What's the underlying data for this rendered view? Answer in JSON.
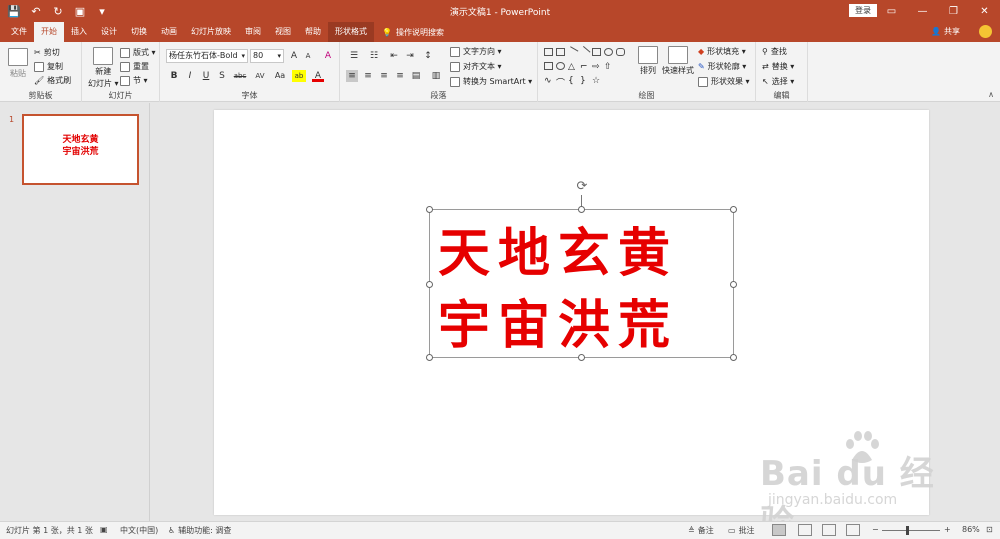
{
  "window": {
    "title": "演示文稿1  -  PowerPoint",
    "login": "登录",
    "minimize": "—",
    "restore": "❐",
    "close": "✕"
  },
  "qat": {
    "save": "💾",
    "undo": "↶",
    "redo": "↻",
    "present": "▣",
    "more": "▾"
  },
  "tabs": [
    {
      "label": "文件"
    },
    {
      "label": "开始"
    },
    {
      "label": "插入"
    },
    {
      "label": "设计"
    },
    {
      "label": "切换"
    },
    {
      "label": "动画"
    },
    {
      "label": "幻灯片放映"
    },
    {
      "label": "审阅"
    },
    {
      "label": "视图"
    },
    {
      "label": "帮助"
    },
    {
      "label": "形状格式"
    }
  ],
  "tell_me": "操作说明搜索",
  "share": "共享",
  "ribbon": {
    "clipboard": {
      "label": "剪贴板",
      "paste": "粘贴",
      "cut": "剪切",
      "copy": "复制",
      "format_painter": "格式刷"
    },
    "slides": {
      "label": "幻灯片",
      "new_slide": "新建",
      "new_slide2": "幻灯片 ▾",
      "layout": "版式 ▾",
      "reset": "重置",
      "section": "节 ▾"
    },
    "font": {
      "label": "字体",
      "font_name": "杨任东竹石体-Bold",
      "font_size": "80",
      "bold": "B",
      "italic": "I",
      "underline": "U",
      "shadow": "S",
      "strike": "abc",
      "spacing": "AV",
      "case": "Aa",
      "grow": "A",
      "shrink": "A",
      "clear": "A",
      "highlight": "ab",
      "color": "A"
    },
    "paragraph": {
      "label": "段落",
      "text_direction": "文字方向 ▾",
      "align_text": "对齐文本 ▾",
      "smartart": "转换为 SmartArt ▾"
    },
    "drawing": {
      "label": "绘图",
      "arrange": "排列",
      "quick_styles": "快速样式",
      "shape_fill": "形状填充 ▾",
      "shape_outline": "形状轮廓 ▾",
      "shape_effects": "形状效果 ▾"
    },
    "editing": {
      "label": "编辑",
      "find": "查找",
      "replace": "替换 ▾",
      "select": "选择 ▾"
    }
  },
  "thumbnails": [
    {
      "number": "1",
      "line1": "天地玄黄",
      "line2": "宇宙洪荒"
    }
  ],
  "slide": {
    "line1": "天地玄黄",
    "line2": "宇宙洪荒",
    "text_color": "#e60000"
  },
  "status": {
    "slide_info": "幻灯片 第 1 张，共 1 张",
    "language": "中文(中国)",
    "accessibility": "辅助功能: 调查",
    "notes": "备注",
    "comments": "批注",
    "zoom_minus": "−",
    "zoom_plus": "+",
    "zoom": "86%",
    "zoom_level": 0.86
  },
  "watermark": {
    "main": "Bai du 经验",
    "sub": "jingyan.baidu.com"
  },
  "colors": {
    "accent": "#b7472a",
    "ribbon": "#f3f3f3",
    "text_red": "#e60000"
  }
}
